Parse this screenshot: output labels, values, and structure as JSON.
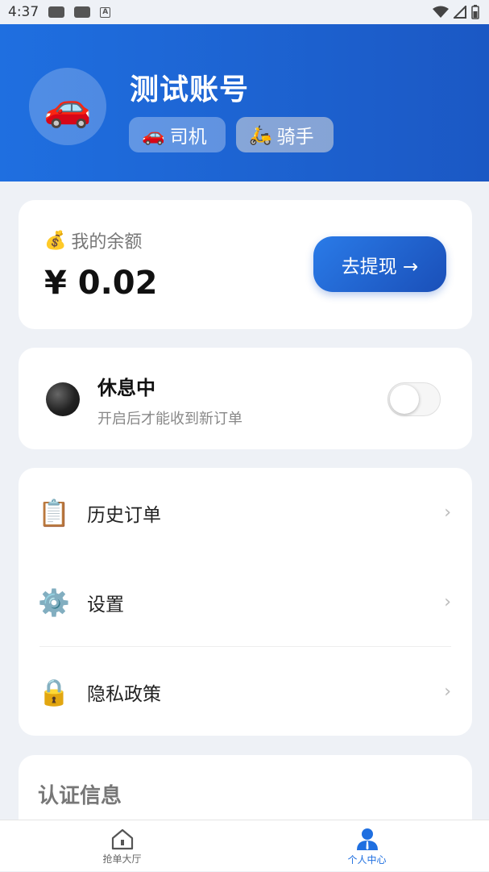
{
  "status_bar": {
    "time": "4:37",
    "a_indicator": "A",
    "icons": [
      "cat-notification-icon",
      "cat-notification-icon",
      "a-icon",
      "wifi-icon",
      "signal-icon",
      "battery-icon"
    ]
  },
  "header": {
    "avatar_emoji": "🚗",
    "username": "测试账号",
    "tags": [
      {
        "emoji": "🚗",
        "label": "司机"
      },
      {
        "emoji": "🛵",
        "label": "骑手"
      }
    ],
    "gradient_colors": [
      "#1f6fe0",
      "#1b58c4"
    ]
  },
  "balance": {
    "emoji": "💰",
    "label": "我的余额",
    "amount": "¥ 0.02",
    "withdraw_label": "去提现 →"
  },
  "work_status": {
    "title": "休息中",
    "subtitle": "开启后才能收到新订单",
    "toggle_on": false
  },
  "menu": {
    "items": [
      {
        "emoji": "📋",
        "label": "历史订单",
        "chevron": "›"
      },
      {
        "emoji": "⚙️",
        "label": "设置",
        "chevron": "›"
      },
      {
        "emoji": "🔒",
        "label": "隐私政策",
        "chevron": "›"
      }
    ]
  },
  "certification": {
    "title": "认证信息"
  },
  "tabbar": {
    "tabs": [
      {
        "label": "抢单大厅",
        "active": false
      },
      {
        "label": "个人中心",
        "active": true
      }
    ],
    "active_color": "#1f6fe0"
  }
}
